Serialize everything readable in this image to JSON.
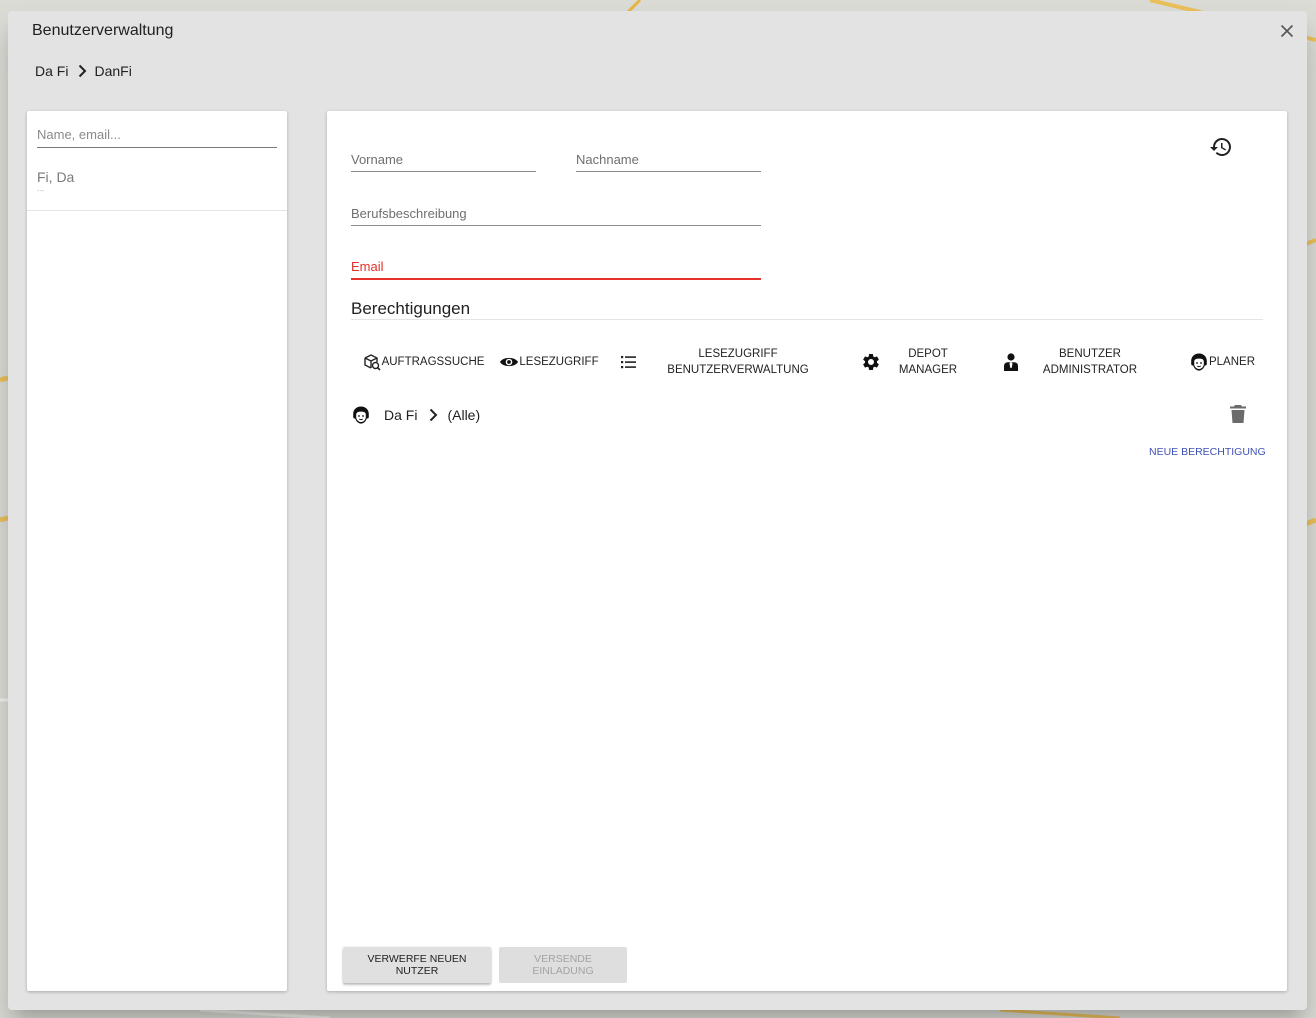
{
  "dialog": {
    "title": "Benutzerverwaltung",
    "breadcrumb": [
      "Da Fi",
      "DanFi"
    ]
  },
  "sidebar": {
    "search_placeholder": "Name, email...",
    "users": [
      {
        "name": "Fi, Da",
        "subtitle": "---"
      }
    ]
  },
  "form": {
    "vorname_placeholder": "Vorname",
    "nachname_placeholder": "Nachname",
    "beruf_placeholder": "Berufsbeschreibung",
    "email_placeholder": "Email",
    "email_state": "error"
  },
  "permissions": {
    "title": "Berechtigungen",
    "types": [
      {
        "label": "AUFTRAGSSUCHE",
        "icon": "cube-search-icon"
      },
      {
        "label": "LESEZUGRIFF",
        "icon": "eye-icon"
      },
      {
        "label": "LESEZUGRIFF\nBENUTZERVERWALTUNG",
        "icon": "list-icon"
      },
      {
        "label": "DEPOT\nMANAGER",
        "icon": "gear-icon"
      },
      {
        "label": "BENUTZER\nADMINISTRATOR",
        "icon": "user-tie-icon"
      },
      {
        "label": "PLANER",
        "icon": "face-agent-icon"
      }
    ],
    "entries": [
      {
        "icon": "face-agent-icon",
        "org": "Da Fi",
        "scope": "(Alle)"
      }
    ],
    "new_label": "NEUE BERECHTIGUNG"
  },
  "actions": {
    "discard_label": "VERWERFE NEUEN NUTZER",
    "send_label": "VERSENDE EINLADUNG",
    "send_disabled": true
  },
  "colors": {
    "accent": "#3f51b5",
    "error": "#e4312a",
    "dialog_bg": "#e3e3e3"
  }
}
